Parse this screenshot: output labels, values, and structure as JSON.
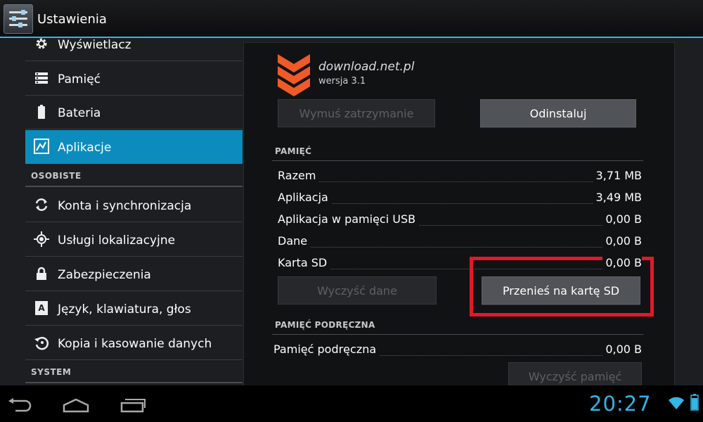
{
  "action_bar": {
    "title": "Ustawienia",
    "icon": "settings-sliders-icon"
  },
  "sidebar": {
    "items": [
      {
        "label": "Wyświetlacz",
        "icon": "gear-icon"
      },
      {
        "label": "Pamięć",
        "icon": "storage-icon"
      },
      {
        "label": "Bateria",
        "icon": "battery-icon"
      },
      {
        "label": "Aplikacje",
        "icon": "apps-icon",
        "active": true
      }
    ],
    "header_personal": "OSOBISTE",
    "personal_items": [
      {
        "label": "Konta i synchronizacja",
        "icon": "sync-icon"
      },
      {
        "label": "Usługi lokalizacyjne",
        "icon": "location-icon"
      },
      {
        "label": "Zabezpieczenia",
        "icon": "lock-icon"
      },
      {
        "label": "Język, klawiatura, głos",
        "icon": "keyboard-language-icon"
      },
      {
        "label": "Kopia i kasowanie danych",
        "icon": "backup-icon"
      }
    ],
    "header_system": "SYSTEM"
  },
  "app_info": {
    "name": "download.net.pl",
    "version": "wersja 3.1",
    "force_stop_label": "Wymuś zatrzymanie",
    "uninstall_label": "Odinstaluj"
  },
  "storage": {
    "header": "PAMIĘĆ",
    "rows": [
      {
        "name": "Razem",
        "value": "3,71 MB"
      },
      {
        "name": "Aplikacja",
        "value": "3,49 MB"
      },
      {
        "name": "Aplikacja w pamięci USB",
        "value": "0,00 B"
      },
      {
        "name": "Dane",
        "value": "0,00 B"
      },
      {
        "name": "Karta SD",
        "value": "0,00 B"
      }
    ],
    "clear_data_label": "Wyczyść dane",
    "move_to_sd_label": "Przenieś na kartę SD"
  },
  "cache": {
    "header": "PAMIĘĆ PODRĘCZNA",
    "row": {
      "name": "Pamięć podręczna",
      "value": "0,00 B"
    },
    "clear_cache_label": "Wyczyść pamięć"
  },
  "nav": {
    "back_icon": "back-icon",
    "home_icon": "home-icon",
    "recents_icon": "recent-apps-icon"
  },
  "status": {
    "time": "20:27",
    "wifi_icon": "wifi-icon",
    "battery_icon": "battery-status-icon"
  },
  "colors": {
    "accent": "#33b5e5",
    "active_item": "#0c8cbd",
    "highlight": "#e3182a",
    "logo": "#f05a28"
  }
}
